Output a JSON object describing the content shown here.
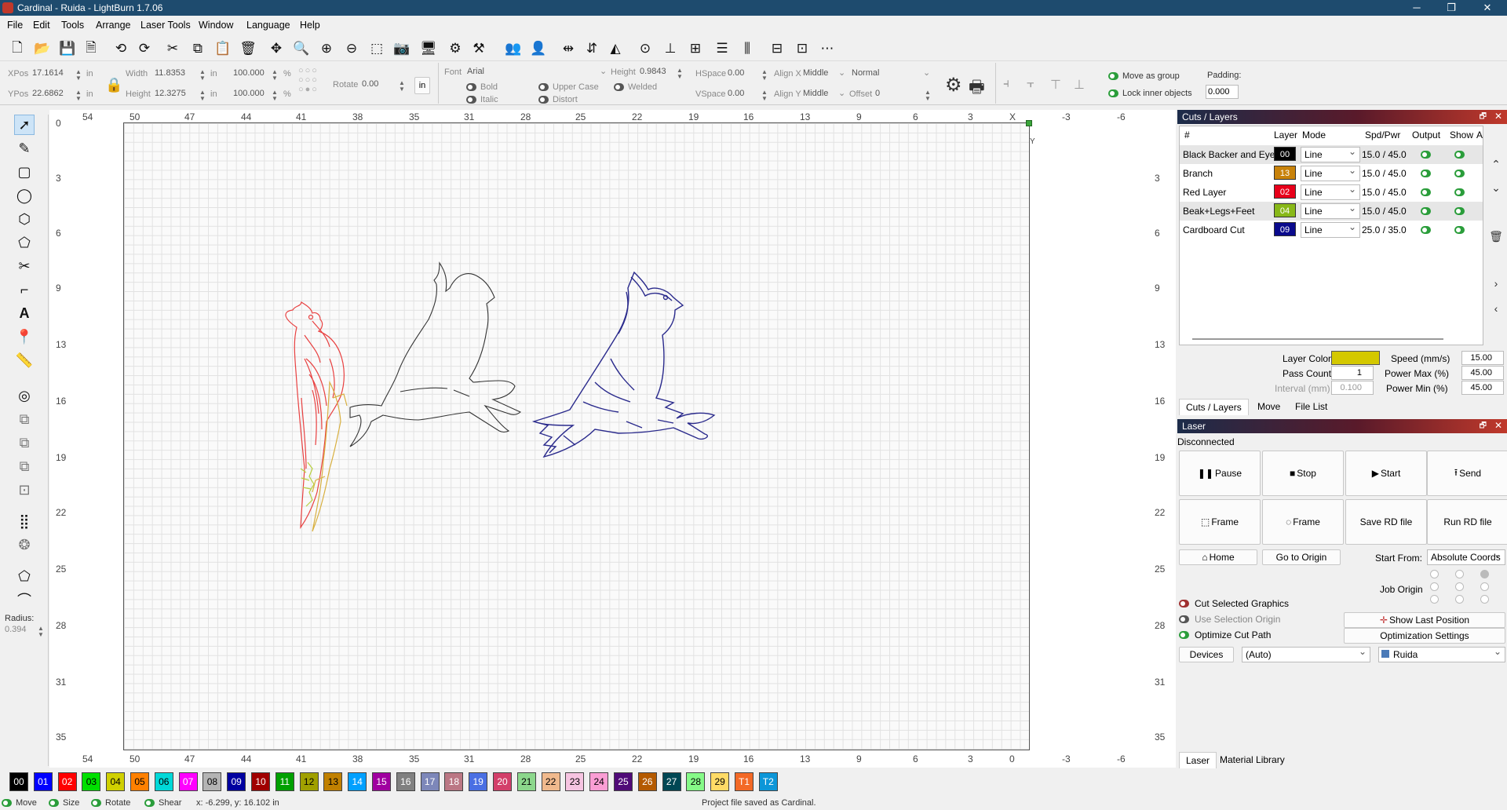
{
  "window": {
    "title": "Cardinal - Ruida - LightBurn 1.7.06"
  },
  "menu": [
    "File",
    "Edit",
    "Tools",
    "Arrange",
    "Laser Tools",
    "Window",
    "Language",
    "Help"
  ],
  "toolbar": {
    "icons": [
      "new-file-icon",
      "open-file-icon",
      "save-icon",
      "save-as-icon",
      "undo-icon",
      "redo-icon",
      "cut-icon",
      "copy-icon",
      "paste-icon",
      "delete-icon",
      "move-icon",
      "zoom-icon",
      "zoom-in-icon",
      "zoom-out-icon",
      "zoom-frame-icon",
      "camera-icon",
      "monitor-icon",
      "settings-icon",
      "tools-icon",
      "group-icon",
      "user-icon",
      "mirror-h-icon",
      "mirror-v-icon",
      "mirror-icon",
      "center-icon",
      "align-bottom-icon",
      "align-h-icon",
      "distribute-icon",
      "distribute-v-icon",
      "dock-icon",
      "dock-v-icon",
      "grid-icon"
    ]
  },
  "props": {
    "xpos_label": "XPos",
    "xpos_value": "17.1614",
    "ypos_label": "YPos",
    "ypos_value": "22.6862",
    "unit": "in",
    "width_label": "Width",
    "width_value": "11.8353",
    "height_label": "Height",
    "height_value": "12.3275",
    "pct1": "100.000",
    "pct2": "100.000",
    "pct_sym": "%",
    "rotate_label": "Rotate",
    "rotate_value": "0.00",
    "unit_btn": "in",
    "font_label": "Font",
    "font_value": "Arial",
    "font_height_label": "Height",
    "font_height_value": "0.9843",
    "hspace_label": "HSpace",
    "hspace_value": "0.00",
    "vspace_label": "VSpace",
    "vspace_value": "0.00",
    "alignx_label": "Align X",
    "alignx_value": "Middle",
    "aligny_label": "Align Y",
    "aligny_value": "Middle",
    "normal_value": "Normal",
    "offset_label": "Offset",
    "offset_value": "0",
    "bold": "Bold",
    "italic": "Italic",
    "upper": "Upper Case",
    "distort": "Distort",
    "welded": "Welded",
    "move_group": "Move as group",
    "lock_inner": "Lock inner objects",
    "padding_label": "Padding:",
    "padding_value": "0.000"
  },
  "rulers": {
    "top": [
      "54",
      "50",
      "47",
      "44",
      "41",
      "38",
      "35",
      "31",
      "28",
      "25",
      "22",
      "19",
      "16",
      "13",
      "9",
      "6",
      "3",
      "X",
      "-3",
      "-6"
    ],
    "bottom": [
      "54",
      "50",
      "47",
      "44",
      "41",
      "38",
      "35",
      "31",
      "28",
      "25",
      "22",
      "19",
      "16",
      "13",
      "9",
      "6",
      "3",
      "0",
      "-3",
      "-6"
    ],
    "left": [
      "0",
      "3",
      "6",
      "9",
      "13",
      "16",
      "19",
      "22",
      "25",
      "28",
      "31",
      "35"
    ],
    "right": [
      "3",
      "6",
      "9",
      "13",
      "16",
      "19",
      "22",
      "25",
      "28",
      "31",
      "35"
    ],
    "y_label": "Y"
  },
  "left_tools": {
    "radius_label": "Radius:",
    "radius_value": "0.394"
  },
  "cuts": {
    "panel_title": "Cuts / Layers",
    "headers": [
      "#",
      "Layer",
      "Mode",
      "Spd/Pwr",
      "Output",
      "Show",
      "A"
    ],
    "rows": [
      {
        "name": "Black Backer and Eye",
        "num": "00",
        "color": "#000000",
        "mode": "Line",
        "spdpwr": "15.0 / 45.0"
      },
      {
        "name": "Branch",
        "num": "13",
        "color": "#c8820a",
        "mode": "Line",
        "spdpwr": "15.0 / 45.0"
      },
      {
        "name": "Red Layer",
        "num": "02",
        "color": "#e8001a",
        "mode": "Line",
        "spdpwr": "15.0 / 45.0"
      },
      {
        "name": "Beak+Legs+Feet",
        "num": "04",
        "color": "#88b818",
        "mode": "Line",
        "spdpwr": "15.0 / 45.0"
      },
      {
        "name": "Cardboard Cut",
        "num": "09",
        "color": "#0a0a8c",
        "mode": "Line",
        "spdpwr": "25.0 / 35.0"
      }
    ],
    "layer_color_label": "Layer Color",
    "layer_color": "#d4c800",
    "speed_label": "Speed (mm/s)",
    "speed_value": "15.00",
    "pass_label": "Pass Count",
    "pass_value": "1",
    "pmax_label": "Power Max (%)",
    "pmax_value": "45.00",
    "interval_label": "Interval (mm)",
    "interval_value": "0.100",
    "pmin_label": "Power Min (%)",
    "pmin_value": "45.00",
    "tabs": [
      "Cuts / Layers",
      "Move",
      "File List"
    ]
  },
  "laser": {
    "panel_title": "Laser",
    "status": "Disconnected",
    "pause": "Pause",
    "stop": "Stop",
    "start": "Start",
    "send": "Send",
    "frame1": "Frame",
    "frame2": "Frame",
    "save_rd": "Save RD file",
    "run_rd": "Run RD file",
    "home": "Home",
    "go_origin": "Go to Origin",
    "start_from_label": "Start From:",
    "start_from_value": "Absolute Coords",
    "job_origin": "Job Origin",
    "cut_selected": "Cut Selected Graphics",
    "use_sel_origin": "Use Selection Origin",
    "optimize": "Optimize Cut Path",
    "show_last": "Show Last Position",
    "opt_settings": "Optimization Settings",
    "devices": "Devices",
    "port_value": "(Auto)",
    "device_value": "Ruida",
    "tabs": [
      "Laser",
      "Material Library"
    ]
  },
  "palette": [
    {
      "label": "00",
      "color": "#000000",
      "fg": "#ffffff"
    },
    {
      "label": "01",
      "color": "#0000ff",
      "fg": "#ffffff"
    },
    {
      "label": "02",
      "color": "#ff0000",
      "fg": "#ffffff"
    },
    {
      "label": "03",
      "color": "#00e000",
      "fg": "#000000"
    },
    {
      "label": "04",
      "color": "#d0d000",
      "fg": "#000000"
    },
    {
      "label": "05",
      "color": "#ff8000",
      "fg": "#000000"
    },
    {
      "label": "06",
      "color": "#00d8d8",
      "fg": "#000000"
    },
    {
      "label": "07",
      "color": "#ff00ff",
      "fg": "#ffffff"
    },
    {
      "label": "08",
      "color": "#b4b4b4",
      "fg": "#000000"
    },
    {
      "label": "09",
      "color": "#0000a0",
      "fg": "#ffffff"
    },
    {
      "label": "10",
      "color": "#a00000",
      "fg": "#ffffff"
    },
    {
      "label": "11",
      "color": "#00a000",
      "fg": "#ffffff"
    },
    {
      "label": "12",
      "color": "#a0a000",
      "fg": "#000000"
    },
    {
      "label": "13",
      "color": "#c08000",
      "fg": "#000000"
    },
    {
      "label": "14",
      "color": "#00a0ff",
      "fg": "#ffffff"
    },
    {
      "label": "15",
      "color": "#a000a0",
      "fg": "#ffffff"
    },
    {
      "label": "16",
      "color": "#808080",
      "fg": "#ffffff"
    },
    {
      "label": "17",
      "color": "#7d87b9",
      "fg": "#ffffff"
    },
    {
      "label": "18",
      "color": "#bb7784",
      "fg": "#ffffff"
    },
    {
      "label": "19",
      "color": "#4a6fe3",
      "fg": "#ffffff"
    },
    {
      "label": "20",
      "color": "#d33f6a",
      "fg": "#ffffff"
    },
    {
      "label": "21",
      "color": "#8cd78c",
      "fg": "#000000"
    },
    {
      "label": "22",
      "color": "#f0b98d",
      "fg": "#000000"
    },
    {
      "label": "23",
      "color": "#f6c4e1",
      "fg": "#000000"
    },
    {
      "label": "24",
      "color": "#fa9ed4",
      "fg": "#000000"
    },
    {
      "label": "25",
      "color": "#500a78",
      "fg": "#ffffff"
    },
    {
      "label": "26",
      "color": "#b45a00",
      "fg": "#ffffff"
    },
    {
      "label": "27",
      "color": "#004754",
      "fg": "#ffffff"
    },
    {
      "label": "28",
      "color": "#86fa88",
      "fg": "#000000"
    },
    {
      "label": "29",
      "color": "#ffdb66",
      "fg": "#000000"
    },
    {
      "label": "T1",
      "color": "#f36926",
      "fg": "#ffffff"
    },
    {
      "label": "T2",
      "color": "#0c96d8",
      "fg": "#ffffff"
    }
  ],
  "status": {
    "move": "Move",
    "size": "Size",
    "rotate": "Rotate",
    "shear": "Shear",
    "coords": "x: -6.299, y: 16.102 in",
    "message": "Project file saved as Cardinal."
  }
}
